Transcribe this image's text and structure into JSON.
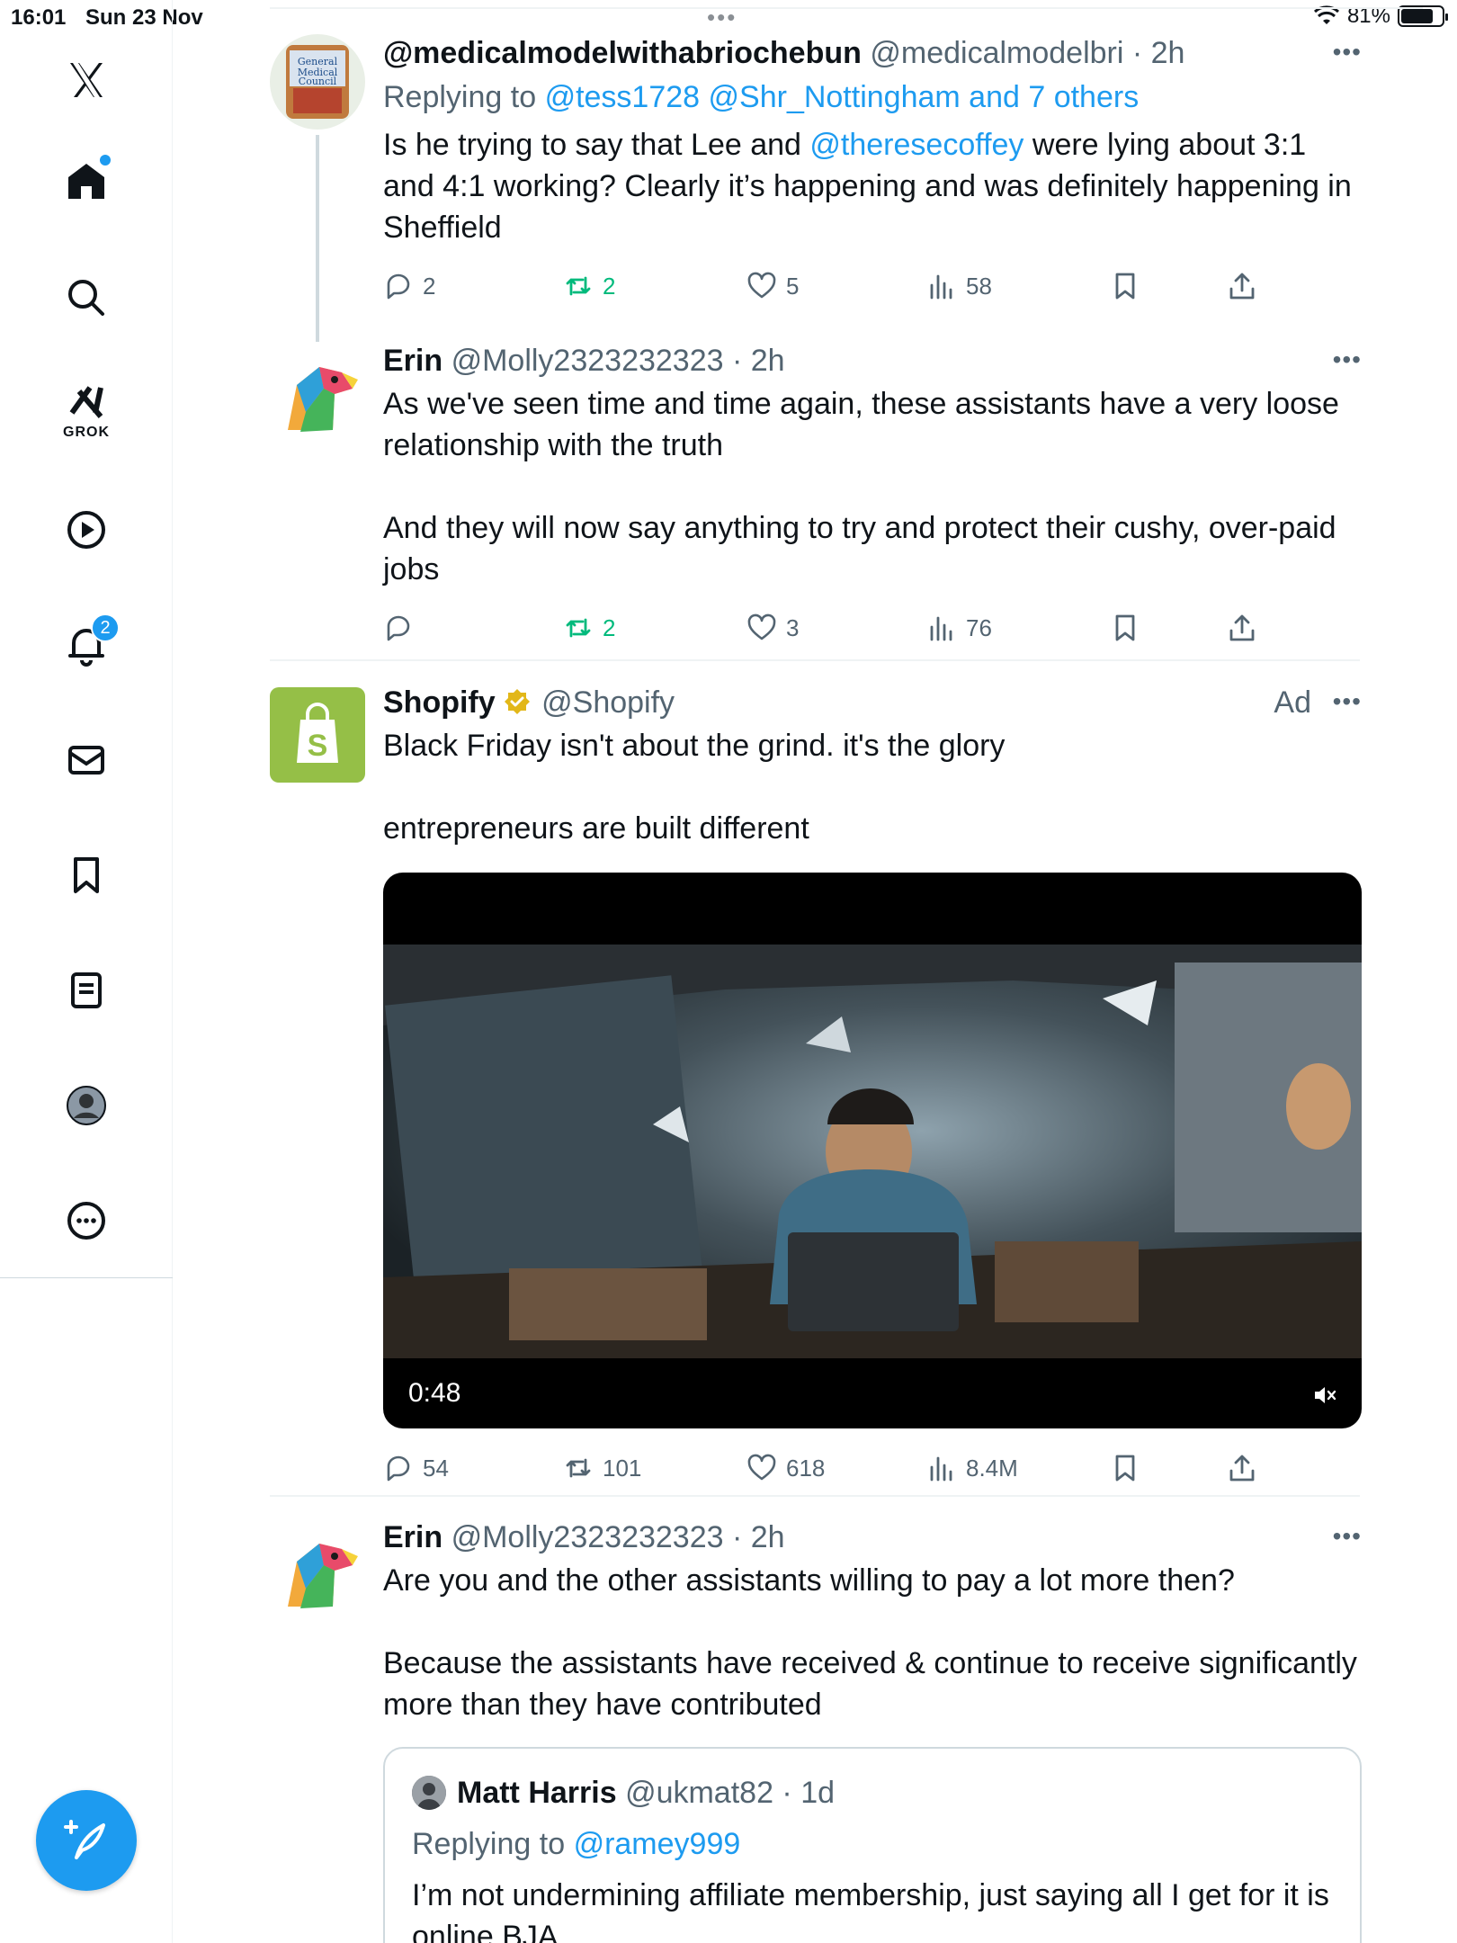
{
  "status_bar": {
    "time": "16:01",
    "date": "Sun 23 Nov",
    "battery": "81%",
    "battery_level": 0.81
  },
  "sidebar": {
    "items": [
      {
        "name": "x-logo",
        "icon": "x-logo-icon"
      },
      {
        "name": "home",
        "icon": "home-icon"
      },
      {
        "name": "search",
        "icon": "search-icon"
      },
      {
        "name": "grok",
        "icon": "grok-icon",
        "label": "GROK"
      },
      {
        "name": "video",
        "icon": "play-icon"
      },
      {
        "name": "notifications",
        "icon": "bell-icon",
        "badge": "2"
      },
      {
        "name": "messages",
        "icon": "mail-icon"
      },
      {
        "name": "bookmarks",
        "icon": "bookmark-icon"
      },
      {
        "name": "lists",
        "icon": "list-icon"
      },
      {
        "name": "profile",
        "icon": "avatar-icon"
      },
      {
        "name": "more",
        "icon": "more-icon"
      }
    ],
    "compose_icon": "compose-icon"
  },
  "accent_color": "#1d9bf0",
  "tweets": [
    {
      "name": "@medicalmodelwithabriochebun",
      "handle": "@medicalmodelbri",
      "time": "2h",
      "replying_prefix": "Replying to",
      "replying_to": "@tess1728 @Shr_Nottingham and 7 others",
      "text_before": "Is he trying to say that Lee and ",
      "mention": "@theresecoffey",
      "text_after": " were lying about 3:1 and 4:1 working? Clearly it’s happening and was definitely happening in Sheffield",
      "replies": "2",
      "retweets": "2",
      "likes": "5",
      "views": "58"
    },
    {
      "name": "Erin",
      "handle": "@Molly2323232323",
      "time": "2h",
      "paragraphs": [
        "As we've seen time and time again, these assistants have a very loose relationship with the truth",
        "And they will now say anything to try and protect their cushy, over-paid jobs"
      ],
      "replies": "",
      "retweets": "2",
      "likes": "3",
      "views": "76"
    },
    {
      "name": "Shopify",
      "handle": "@Shopify",
      "ad_label": "Ad",
      "paragraphs": [
        "Black Friday isn't about the grind. it's the glory",
        "entrepreneurs are built different"
      ],
      "video_duration": "0:48",
      "replies": "54",
      "retweets": "101",
      "likes": "618",
      "views": "8.4M"
    },
    {
      "name": "Erin",
      "handle": "@Molly2323232323",
      "time": "2h",
      "paragraphs": [
        "Are you and the other assistants willing to pay a lot more then?",
        "Because the assistants have received & continue to receive significantly more than they have  contributed"
      ],
      "quote": {
        "name": "Matt Harris",
        "handle": "@ukmat82",
        "time": "1d",
        "replying_prefix": "Replying to",
        "replying_to": "@ramey999",
        "text": "I’m not undermining affiliate membership, just saying all I get for it is online BJA"
      }
    }
  ]
}
